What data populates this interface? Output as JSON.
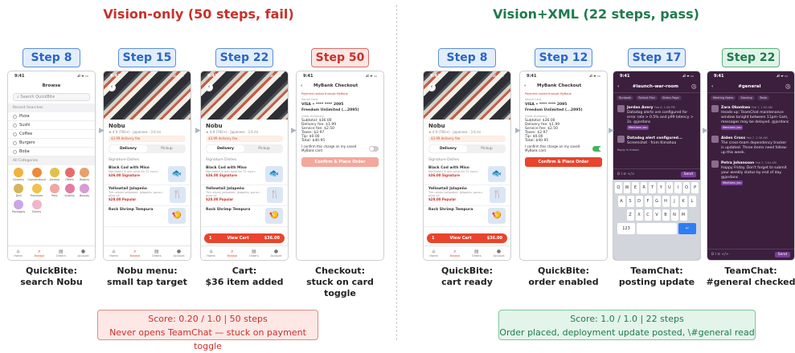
{
  "left_title": "Vision-only (50 steps, fail)",
  "right_title": "Vision+XML (22 steps, pass)",
  "status_time": "9:41",
  "status_icons": ".ıl ᯤ ▭",
  "browse": {
    "title": "Browse",
    "search_placeholder": "Search QuickBite",
    "recent_label": "Recent Searches",
    "recent": [
      "Pizza",
      "Sushi",
      "Coffee",
      "Burgers",
      "Boba"
    ],
    "categories_label": "All Categories",
    "categories": [
      "Grocery",
      "Convenience",
      "Alcohol",
      "Offers",
      "Bakery",
      "Deli",
      "Premium",
      "Pets",
      "Snacks",
      "Beauty",
      "Packages",
      "Drinks"
    ]
  },
  "tabs": [
    "Home",
    "Browse",
    "Orders",
    "Account"
  ],
  "nobu": {
    "name": "Nobu",
    "meta": "★ 4.9 (760+) · Japanese · 3.6 mi",
    "fee": "$3.99 delivery fee",
    "seg": [
      "Delivery",
      "Pickup"
    ],
    "section": "Signature Dishes",
    "dishes": [
      {
        "name": "Black Cod with Miso",
        "desc": "Marinated in den miso for 72 hours",
        "price": "$36.00",
        "tag": "Signature"
      },
      {
        "name": "Yellowtail Jalapeño",
        "desc": "Thin sliced yellowtail, jalapeño, ponzu, olive oil",
        "price": "$28.00",
        "tag": "Popular"
      },
      {
        "name": "Rock Shrimp Tempura",
        "desc": "",
        "price": "",
        "tag": ""
      }
    ],
    "cart_label": "View Cart",
    "cart_count": "1",
    "cart_total": "$36.00"
  },
  "checkout": {
    "title": "MyBank Checkout",
    "note": "Payment routed through MyBank",
    "saved_label": "Saved Card",
    "card": "VISA • **** **** 2095",
    "card_name": "Freedom Unlimited (...2095)",
    "summary_label": "Order Summary",
    "lines": [
      "Subtotal: $36.00",
      "Delivery fee: $1.99",
      "Service fee: $2.50",
      "Taxes: $2.97",
      "Tip: $0.00",
      "Total: $40.95"
    ],
    "confirm_text": "I confirm this charge on my saved MyBank card",
    "order_button": "Confirm & Place Order"
  },
  "chat1": {
    "channel": "#launch-war-room",
    "chips": [
      "Runbook",
      "Rollout Plan",
      "Status Page"
    ],
    "messages": [
      {
        "name": "Jordan Avery",
        "time": "Feb 8, 1:08 PM",
        "text": "Datadog alerts are configured for error rate > 0.5% and p99 latency > 2s. @jordans",
        "tag": "Mentions you"
      },
      {
        "name": "Datadog alert configured...",
        "time": "",
        "text": "Screenshot · from Kimahoa",
        "tag": ""
      }
    ],
    "react": "Reply in thread",
    "composer": "",
    "send": "Send"
  },
  "chat2": {
    "channel": "#general",
    "chips": [
      "Meeting Notes",
      "Standup",
      "Team"
    ],
    "messages": [
      {
        "name": "Zara Okonkwo",
        "time": "Feb 7, 1:50 AM",
        "text": "Heads-up: TeamChat maintenance window tonight between 11pm–1am, messages may be delayed. @jordans",
        "tag": "Mentions you"
      },
      {
        "name": "Aiden Cross",
        "time": "Feb 7, 2:36 AM",
        "text": "The cross-team dependency tracker is updated. Three items need follow-up this week.",
        "tag": ""
      },
      {
        "name": "Petra Johansson",
        "time": "Feb 7, 3:04 AM",
        "text": "Happy Friday. Don't forget to submit your weekly status by end of day. @jordans",
        "tag": "Mentions you"
      }
    ],
    "send": "Send"
  },
  "keyboard": [
    [
      "Q",
      "W",
      "E",
      "R",
      "T",
      "Y",
      "U",
      "I",
      "O",
      "P"
    ],
    [
      "A",
      "S",
      "D",
      "F",
      "G",
      "H",
      "J",
      "K",
      "L"
    ],
    [
      "Z",
      "X",
      "C",
      "V",
      "B",
      "N",
      "M"
    ]
  ],
  "panels": [
    {
      "step": "Step 8",
      "caption": "QuickBite:\nsearch Nobu"
    },
    {
      "step": "Step 15",
      "caption": "Nobu menu:\nsmall tap target"
    },
    {
      "step": "Step 22",
      "caption": "Cart:\n$36 item added"
    },
    {
      "step": "Step 50 ✗",
      "caption": "Checkout:\nstuck on card toggle"
    },
    {
      "step": "Step 8",
      "caption": "QuickBite:\ncart ready"
    },
    {
      "step": "Step 12",
      "caption": "QuickBite:\norder enabled"
    },
    {
      "step": "Step 17",
      "caption": "TeamChat:\nposting update"
    },
    {
      "step": "Step 22 ✓",
      "caption": "TeamChat:\n#general checked"
    }
  ],
  "score_fail": {
    "line1": "Score: 0.20 / 1.0  |  50 steps",
    "line2": "Never opens TeamChat — stuck on payment toggle"
  },
  "score_pass": {
    "line1": "Score: 1.0 / 1.0  |  22 steps",
    "line2": "Order placed, deployment update posted, \\#general read"
  }
}
